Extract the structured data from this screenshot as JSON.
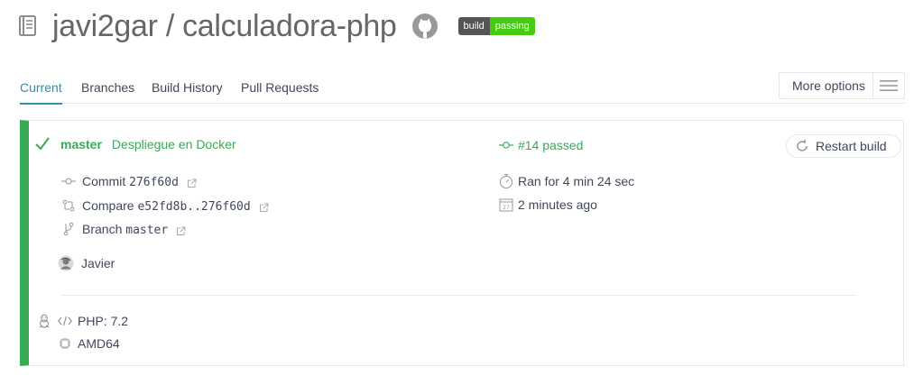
{
  "header": {
    "repo_title": "javi2gar / calculadora-php",
    "badge_left": "build",
    "badge_right": "passing"
  },
  "tabs": [
    {
      "label": "Current",
      "active": true
    },
    {
      "label": "Branches",
      "active": false
    },
    {
      "label": "Build History",
      "active": false
    },
    {
      "label": "Pull Requests",
      "active": false
    }
  ],
  "more_options": {
    "label": "More options"
  },
  "build": {
    "status": "passed",
    "branch": "master",
    "commit_message": "Despliegue en Docker",
    "number_text": "#14 passed",
    "restart_label": "Restart build",
    "commit_label": "Commit",
    "commit_sha": "276f60d",
    "compare_label": "Compare",
    "compare_range": "e52fd8b..276f60d",
    "branch_label": "Branch",
    "branch_value": "master",
    "duration": "Ran for 4 min 24 sec",
    "finished": "2 minutes ago",
    "author": "Javier",
    "language": "PHP: 7.2",
    "arch": "AMD64"
  },
  "colors": {
    "passed_green": "#39aa56",
    "tab_active": "#328fa8",
    "text": "#3f475a"
  },
  "icons": [
    "repo-icon",
    "github-icon",
    "check-icon",
    "commit-icon",
    "compare-icon",
    "branch-icon",
    "external-link-icon",
    "stopwatch-icon",
    "calendar-icon",
    "restart-icon",
    "avatar",
    "linux-icon",
    "code-icon",
    "cpu-icon",
    "hamburger-icon"
  ]
}
